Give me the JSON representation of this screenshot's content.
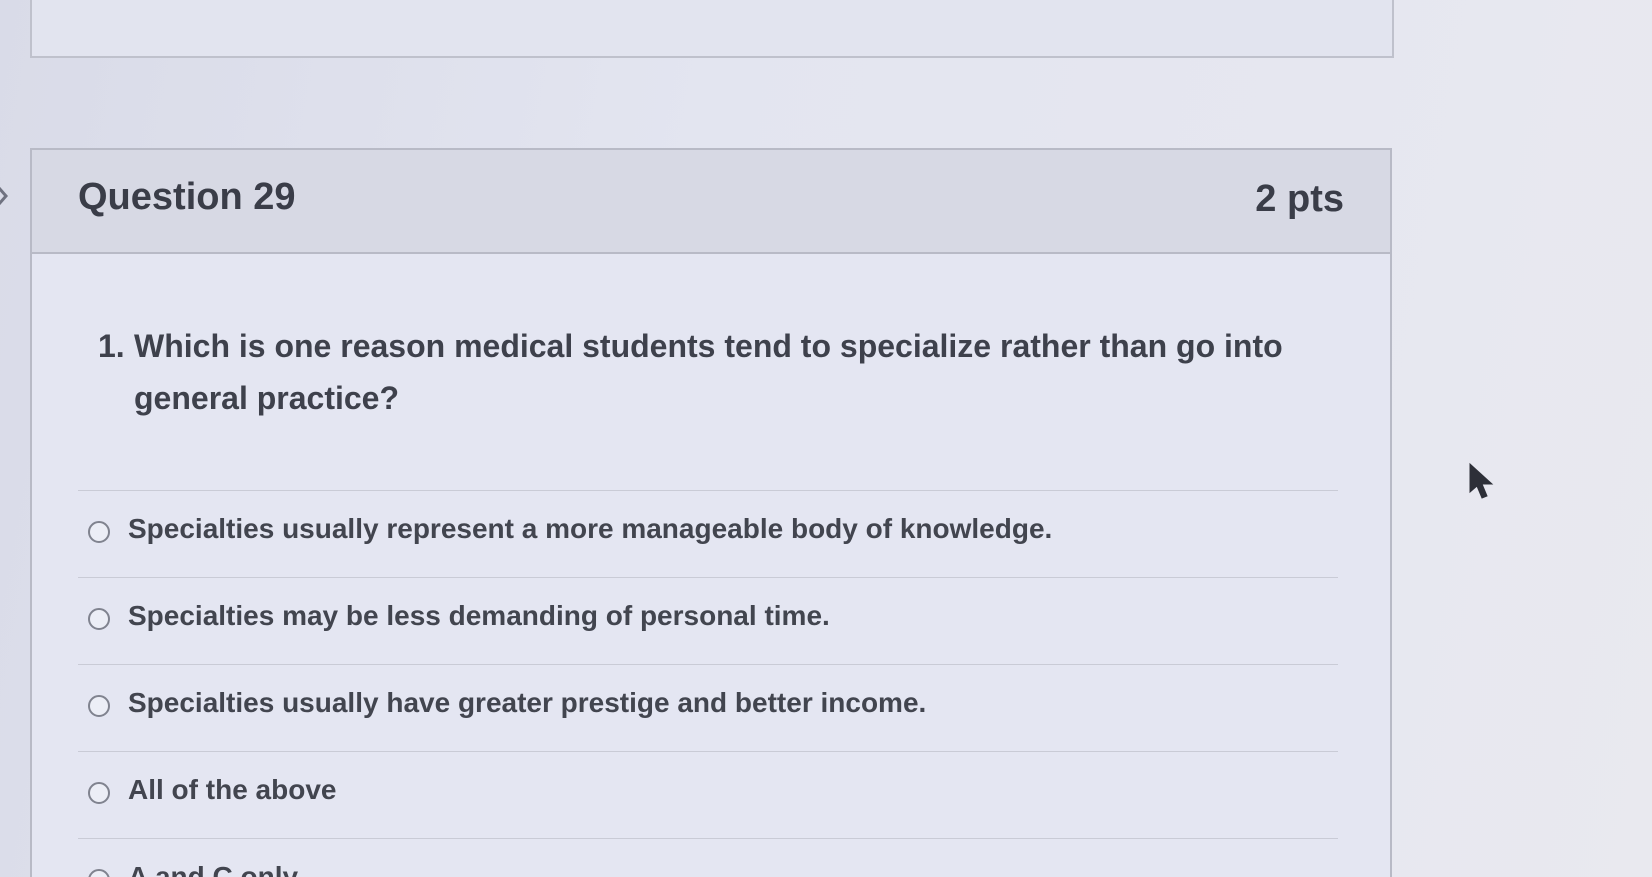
{
  "question": {
    "title": "Question 29",
    "points": "2 pts",
    "number": "1.",
    "text": "Which is one reason medical students tend to specialize rather than go into general practice?"
  },
  "answers": [
    {
      "label": "Specialties usually represent a more manageable body of knowledge.",
      "selected": false
    },
    {
      "label": "Specialties may be less demanding of personal time.",
      "selected": false
    },
    {
      "label": "Specialties usually have greater prestige and better income.",
      "selected": false
    },
    {
      "label": "All of the above",
      "selected": false
    },
    {
      "label": "A and C only",
      "selected": false
    }
  ],
  "icons": {
    "side_arrow": "chevron-right-icon",
    "cursor": "mouse-pointer-icon"
  },
  "colors": {
    "card_background": "#e4e6f2",
    "header_background": "#d7d9e4",
    "border": "#b8bac6",
    "text": "#3a3d48"
  }
}
